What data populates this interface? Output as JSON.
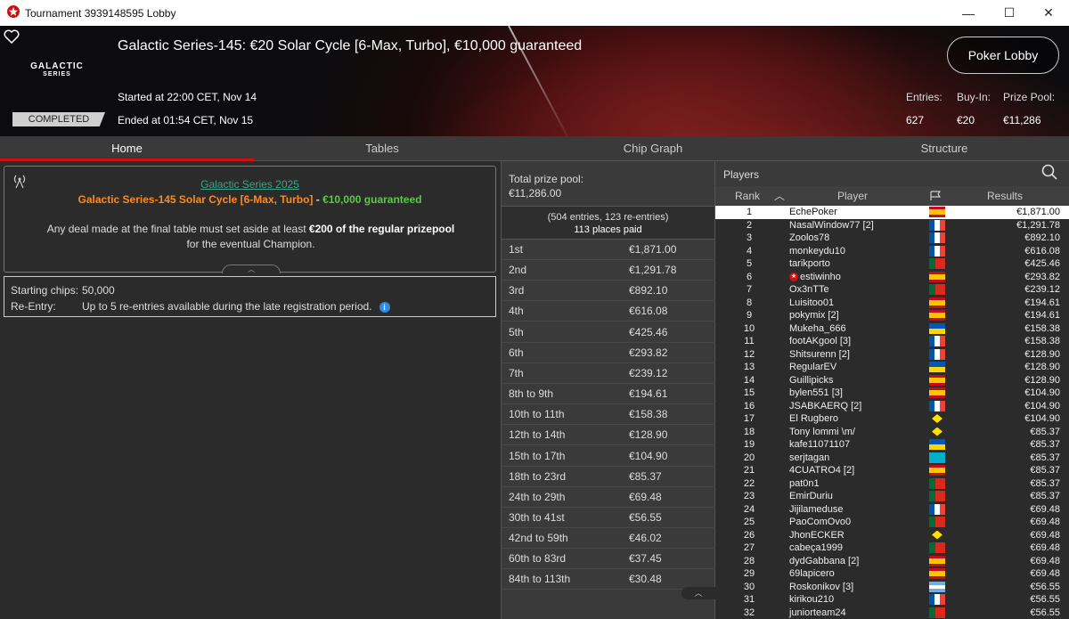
{
  "window": {
    "title": "Tournament 3939148595 Lobby",
    "minimize": "—",
    "maximize": "☐",
    "close": "✕"
  },
  "banner": {
    "logo_line1": "GALACTIC",
    "logo_line2": "SERIES",
    "title": "Galactic Series-145: €20 Solar Cycle [6-Max, Turbo], €10,000 guaranteed",
    "started": "Started at 22:00 CET, Nov 14",
    "ended": "Ended at 01:54 CET, Nov 15",
    "status": "COMPLETED",
    "lobby_button": "Poker Lobby",
    "entries_label": "Entries:",
    "entries_value": "627",
    "buyin_label": "Buy-In:",
    "buyin_value": "€20",
    "prizepool_label": "Prize Pool:",
    "prizepool_value": "€11,286"
  },
  "tabs": [
    "Home",
    "Tables",
    "Chip Graph",
    "Structure"
  ],
  "home": {
    "series_link": "Galactic Series 2025",
    "series_name": "Galactic Series-145 Solar Cycle [6-Max, Turbo]",
    "series_sep": " - ",
    "series_guarantee": "€10,000 guaranteed",
    "deal_pre": "Any deal made at the final table must set aside at least ",
    "deal_bold": "€200 of the regular prizepool",
    "deal_post": "for the eventual Champion.",
    "starting_chips_label": "Starting chips:",
    "starting_chips_value": "50,000",
    "reentry_label": "Re-Entry:",
    "reentry_value": "Up to 5 re-entries available during the late registration period."
  },
  "prize": {
    "total_label": "Total prize pool:",
    "total_value": "€11,286.00",
    "entries_line": "(504 entries, 123 re-entries)",
    "places_paid": "113 places paid",
    "rows": [
      {
        "place": "1st",
        "amount": "€1,871.00"
      },
      {
        "place": "2nd",
        "amount": "€1,291.78"
      },
      {
        "place": "3rd",
        "amount": "€892.10"
      },
      {
        "place": "4th",
        "amount": "€616.08"
      },
      {
        "place": "5th",
        "amount": "€425.46"
      },
      {
        "place": "6th",
        "amount": "€293.82"
      },
      {
        "place": "7th",
        "amount": "€239.12"
      },
      {
        "place": "8th to 9th",
        "amount": "€194.61"
      },
      {
        "place": "10th to 11th",
        "amount": "€158.38"
      },
      {
        "place": "12th to 14th",
        "amount": "€128.90"
      },
      {
        "place": "15th to 17th",
        "amount": "€104.90"
      },
      {
        "place": "18th to 23rd",
        "amount": "€85.37"
      },
      {
        "place": "24th to 29th",
        "amount": "€69.48"
      },
      {
        "place": "30th to 41st",
        "amount": "€56.55"
      },
      {
        "place": "42nd to 59th",
        "amount": "€46.02"
      },
      {
        "place": "60th to 83rd",
        "amount": "€37.45"
      },
      {
        "place": "84th to 113th",
        "amount": "€30.48"
      }
    ]
  },
  "players": {
    "header": "Players",
    "col_rank": "Rank",
    "col_player": "Player",
    "col_results": "Results",
    "rows": [
      {
        "rank": "1",
        "name": "EchePoker",
        "flag": "es",
        "result": "€1,871.00"
      },
      {
        "rank": "2",
        "name": "NasalWindow77 [2]",
        "flag": "fr",
        "result": "€1,291.78"
      },
      {
        "rank": "3",
        "name": "Zoolos78",
        "flag": "fr",
        "result": "€892.10"
      },
      {
        "rank": "4",
        "name": "monkeydu10",
        "flag": "fr",
        "result": "€616.08"
      },
      {
        "rank": "5",
        "name": "tarikporto",
        "flag": "pt",
        "result": "€425.46"
      },
      {
        "rank": "6",
        "name": "estiwinho",
        "flag": "es",
        "result": "€293.82",
        "star": true
      },
      {
        "rank": "7",
        "name": "Ox3nTTe",
        "flag": "pt",
        "result": "€239.12"
      },
      {
        "rank": "8",
        "name": "Luisitoo01",
        "flag": "es",
        "result": "€194.61"
      },
      {
        "rank": "9",
        "name": "pokymix [2]",
        "flag": "es",
        "result": "€194.61"
      },
      {
        "rank": "10",
        "name": "Mukeha_666",
        "flag": "ua",
        "result": "€158.38"
      },
      {
        "rank": "11",
        "name": "footAKgool [3]",
        "flag": "fr",
        "result": "€158.38"
      },
      {
        "rank": "12",
        "name": "Shitsurenn [2]",
        "flag": "fr",
        "result": "€128.90"
      },
      {
        "rank": "13",
        "name": "RegularEV",
        "flag": "ua",
        "result": "€128.90"
      },
      {
        "rank": "14",
        "name": "Guillipicks",
        "flag": "es",
        "result": "€128.90"
      },
      {
        "rank": "15",
        "name": "bylen551 [3]",
        "flag": "es",
        "result": "€104.90"
      },
      {
        "rank": "16",
        "name": "JSABKAERQ [2]",
        "flag": "fr",
        "result": "€104.90"
      },
      {
        "rank": "17",
        "name": "El Rugbero",
        "flag": "br",
        "result": "€104.90"
      },
      {
        "rank": "18",
        "name": "Tony lommi \\m/",
        "flag": "br",
        "result": "€85.37"
      },
      {
        "rank": "19",
        "name": "kafe11071107",
        "flag": "ua",
        "result": "€85.37"
      },
      {
        "rank": "20",
        "name": "serjtagan",
        "flag": "kz",
        "result": "€85.37"
      },
      {
        "rank": "21",
        "name": "4CUATRO4 [2]",
        "flag": "es",
        "result": "€85.37"
      },
      {
        "rank": "22",
        "name": "pat0n1",
        "flag": "pt",
        "result": "€85.37"
      },
      {
        "rank": "23",
        "name": "EmirDuriu",
        "flag": "pt",
        "result": "€85.37"
      },
      {
        "rank": "24",
        "name": "Jijilameduse",
        "flag": "fr",
        "result": "€69.48"
      },
      {
        "rank": "25",
        "name": "PaoComOvo0",
        "flag": "pt",
        "result": "€69.48"
      },
      {
        "rank": "26",
        "name": "JhonECKER",
        "flag": "br",
        "result": "€69.48"
      },
      {
        "rank": "27",
        "name": "cabeça1999",
        "flag": "pt",
        "result": "€69.48"
      },
      {
        "rank": "28",
        "name": "dydGabbana [2]",
        "flag": "es",
        "result": "€69.48"
      },
      {
        "rank": "29",
        "name": "69lapicero",
        "flag": "es",
        "result": "€69.48"
      },
      {
        "rank": "30",
        "name": "Roskonikov [3]",
        "flag": "ar",
        "result": "€56.55"
      },
      {
        "rank": "31",
        "name": "kirikou210",
        "flag": "fr",
        "result": "€56.55"
      },
      {
        "rank": "32",
        "name": "juniorteam24",
        "flag": "pt",
        "result": "€56.55"
      }
    ]
  },
  "colors": {
    "accent_red": "#d01010",
    "orange": "#ff8a1e",
    "green": "#5fc84a",
    "link": "#3aa58a"
  }
}
